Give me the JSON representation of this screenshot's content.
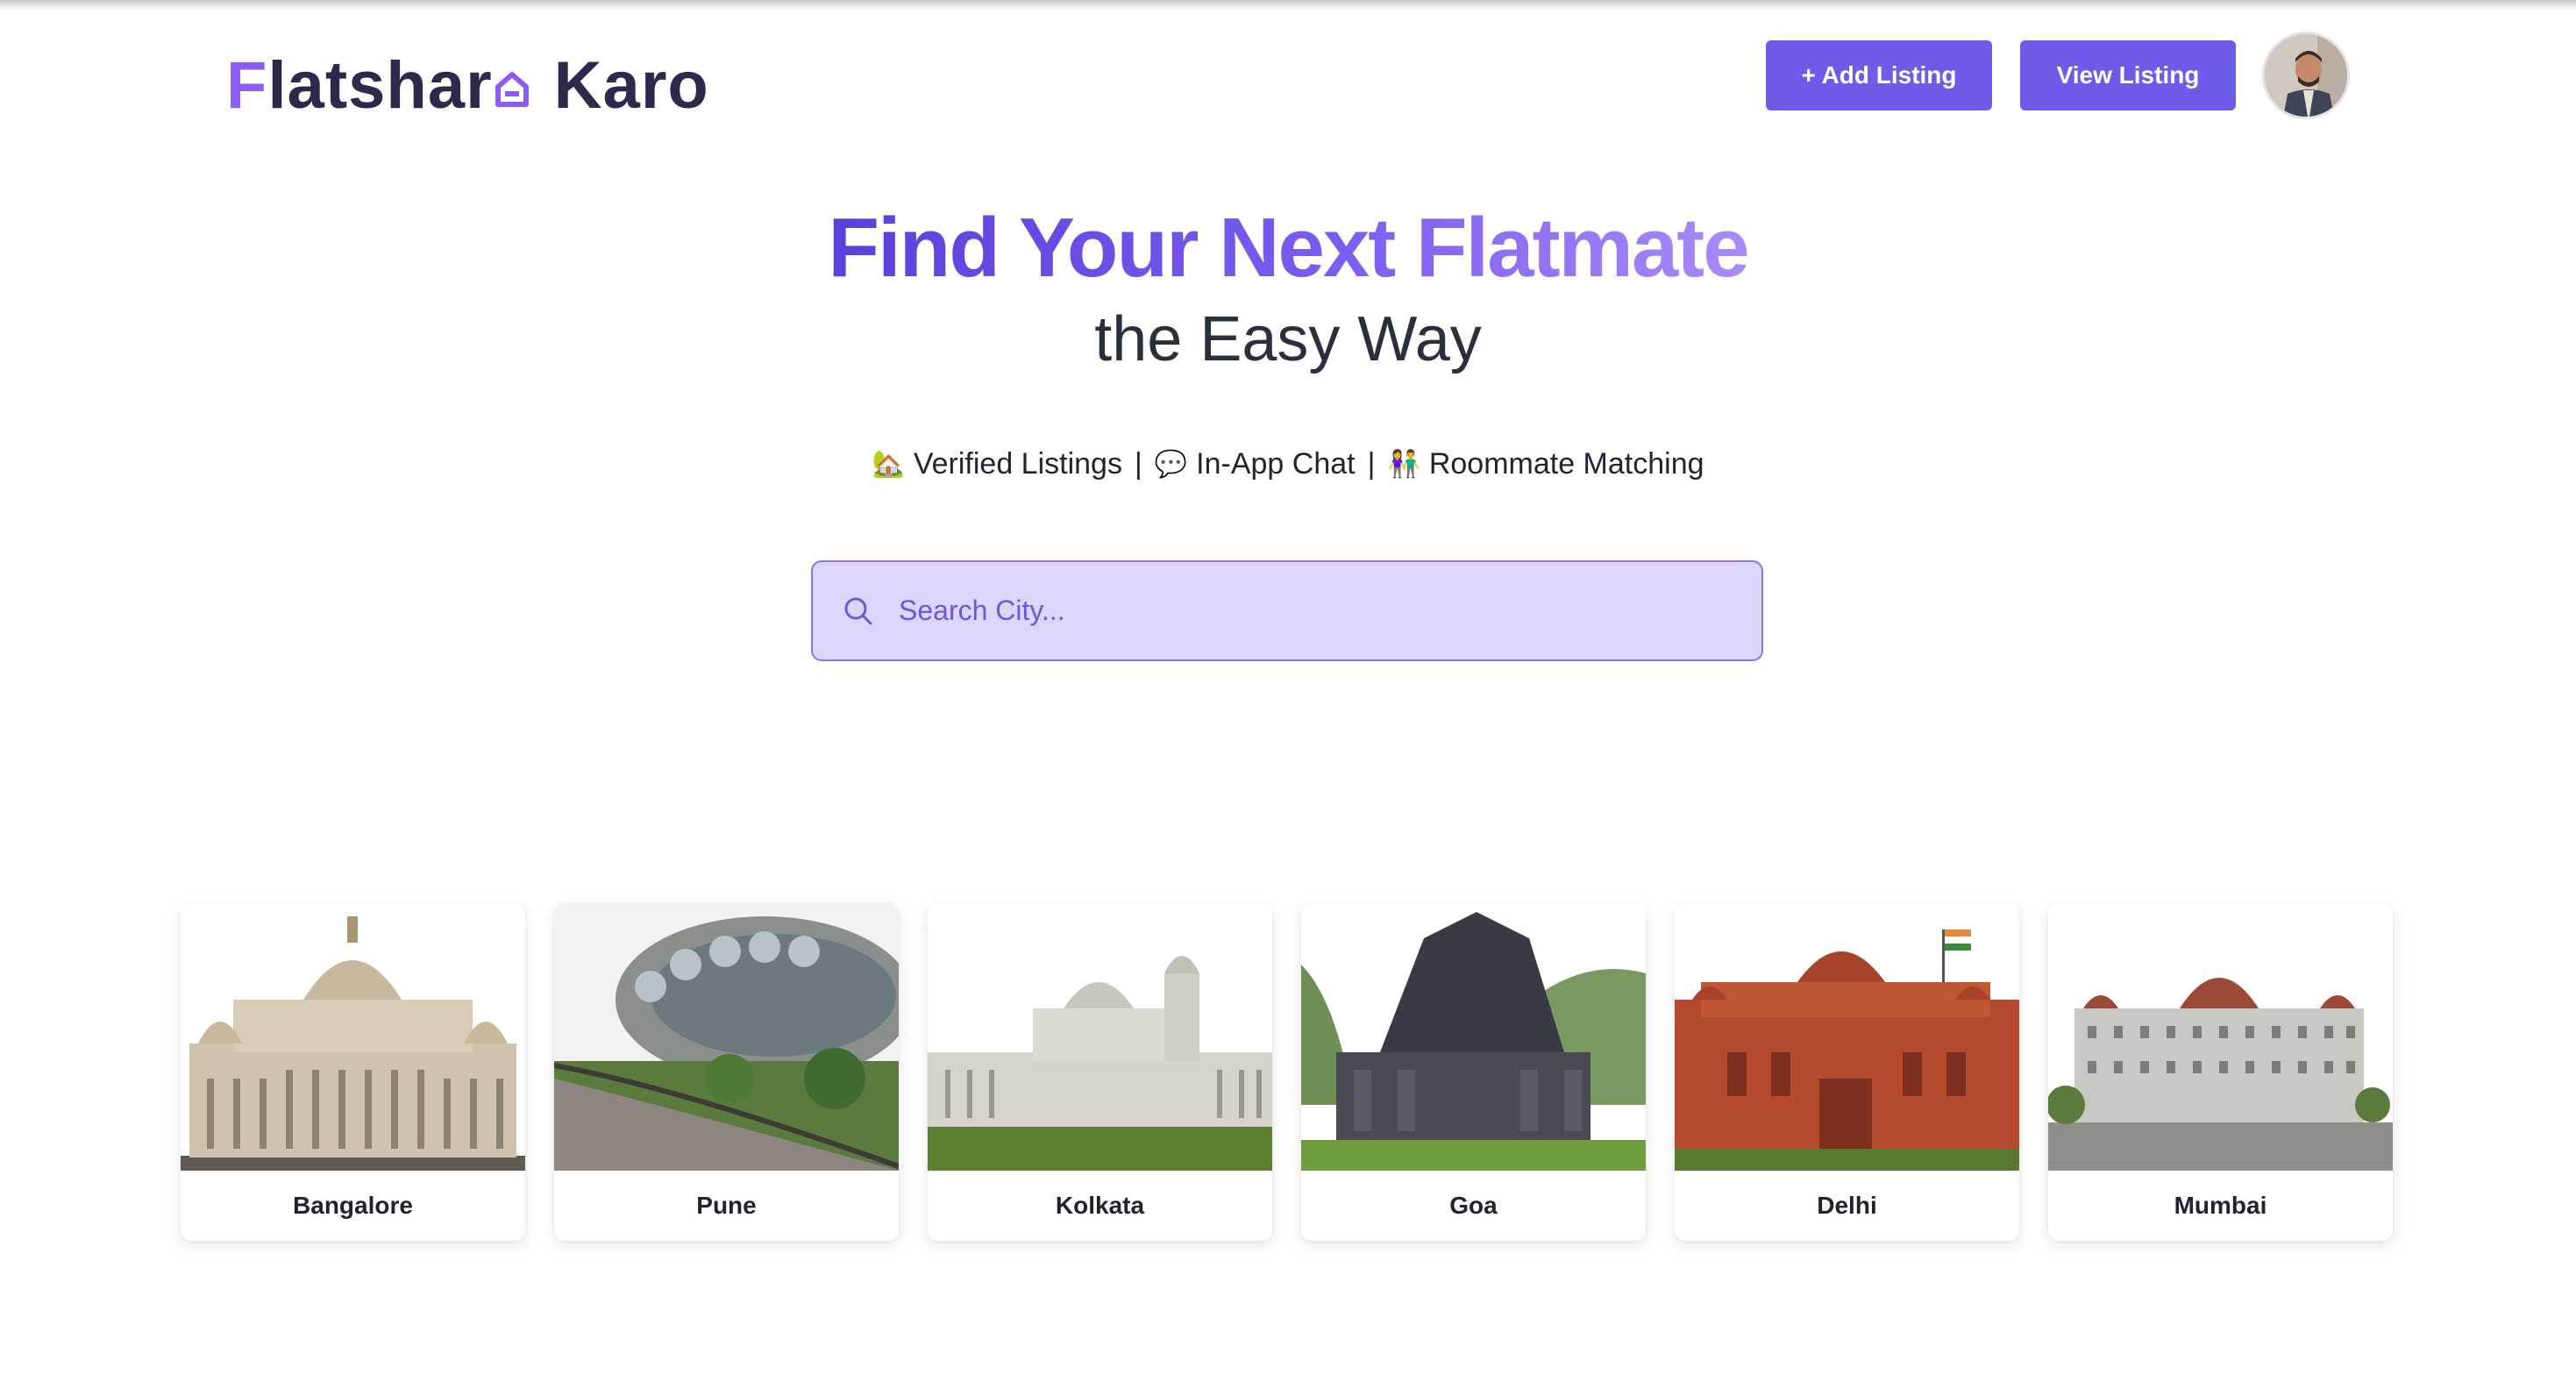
{
  "logo": {
    "part1_first": "F",
    "part1_rest": "latshar",
    "part2": "Karo"
  },
  "header": {
    "add_label": "+ Add Listing",
    "view_label": "View Listing"
  },
  "hero": {
    "title": "Find Your Next Flatmate",
    "subtitle": "the Easy Way",
    "features": [
      {
        "emoji": "🏡",
        "label": "Verified Listings"
      },
      {
        "emoji": "💬",
        "label": "In-App Chat"
      },
      {
        "emoji": "👫",
        "label": "Roommate Matching"
      }
    ],
    "separator": "|"
  },
  "search": {
    "placeholder": "Search City...",
    "value": ""
  },
  "cities": [
    {
      "name": "Bangalore"
    },
    {
      "name": "Pune"
    },
    {
      "name": "Kolkata"
    },
    {
      "name": "Goa"
    },
    {
      "name": "Delhi"
    },
    {
      "name": "Mumbai"
    }
  ],
  "colors": {
    "accent": "#6c5ce7",
    "search_bg": "#ddd6fa",
    "logo_dark": "#2b2a4c"
  }
}
